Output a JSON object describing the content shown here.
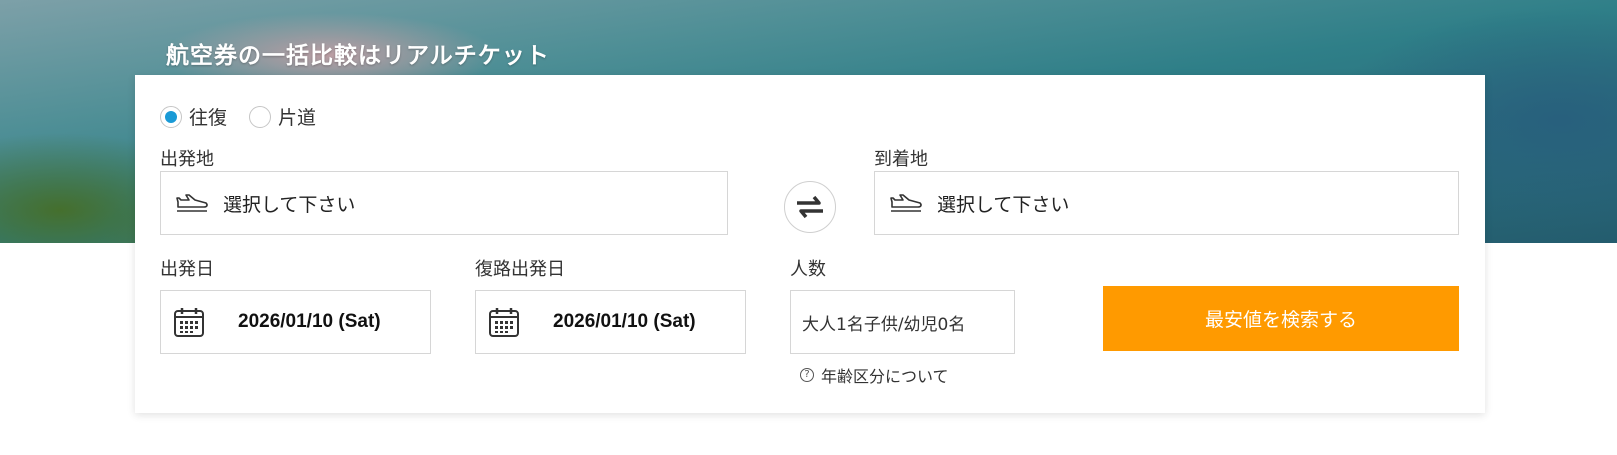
{
  "hero": {
    "title": "航空券の一括比較はリアルチケット"
  },
  "trip_type": {
    "options": [
      {
        "label": "往復",
        "selected": true
      },
      {
        "label": "片道",
        "selected": false
      }
    ]
  },
  "origin": {
    "label": "出発地",
    "placeholder": "選択して下さい",
    "icon": "takeoff-plane-icon"
  },
  "destination": {
    "label": "到着地",
    "placeholder": "選択して下さい",
    "icon": "landing-plane-icon"
  },
  "swap": {
    "icon": "swap-arrows-icon"
  },
  "depart_date": {
    "label": "出発日",
    "value": "2026/01/10 (Sat)",
    "icon": "calendar-icon"
  },
  "return_date": {
    "label": "復路出発日",
    "value": "2026/01/10 (Sat)",
    "icon": "calendar-icon"
  },
  "passengers": {
    "label": "人数",
    "value": "大人1名子供/幼児0名"
  },
  "age_info": {
    "label": "年齢区分について",
    "icon": "question-circle-icon"
  },
  "search": {
    "label": "最安値を検索する"
  },
  "colors": {
    "accent": "#ff9a00",
    "radio": "#1a9ad6"
  }
}
